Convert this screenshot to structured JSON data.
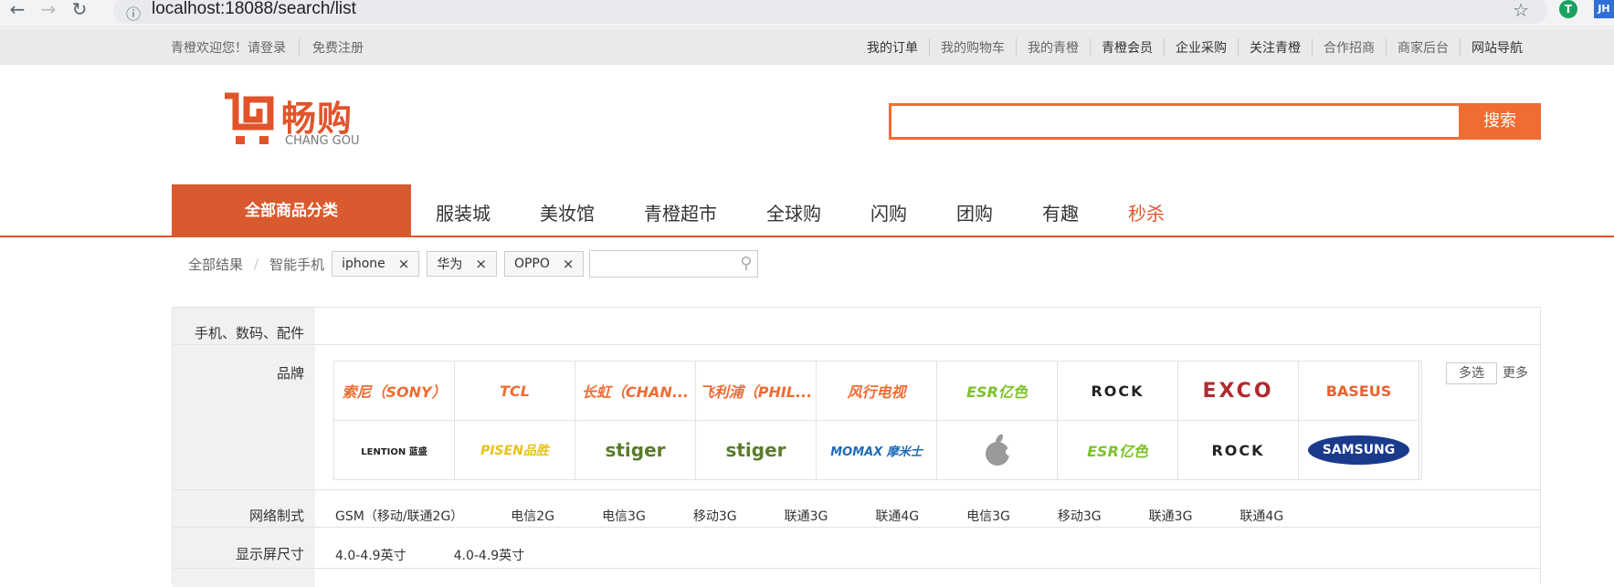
{
  "browser": {
    "url": "localhost:18088/search/list",
    "ext2": "JH"
  },
  "topbar": {
    "welcome": "青橙欢迎您！请登录",
    "register": "免费注册",
    "links": [
      "我的订单",
      "我的购物车",
      "我的青橙",
      "青橙会员",
      "企业采购",
      "关注青橙",
      "合作招商",
      "商家后台",
      "网站导航"
    ]
  },
  "logo": {
    "cn": "畅购",
    "en": "CHANG GOU"
  },
  "search": {
    "button": "搜索",
    "value": ""
  },
  "nav": {
    "all": "全部商品分类",
    "items": [
      "服装城",
      "美妆馆",
      "青橙超市",
      "全球购",
      "闪购",
      "团购",
      "有趣",
      "秒杀"
    ]
  },
  "breadcrumb": {
    "root": "全部结果",
    "sep": "/",
    "current": "智能手机",
    "tags": [
      "iphone",
      "华为",
      "OPPO"
    ],
    "close": "×"
  },
  "filters": {
    "category": "手机、数码、配件",
    "brand_label": "品牌",
    "brands_row1": [
      "索尼（SONY）",
      "TCL",
      "长虹（CHAN...",
      "飞利浦（PHIL...",
      "风行电视",
      "ESR亿色",
      "ROCK",
      "EXCO",
      "BASEUS"
    ],
    "brands_row2": [
      "LENTION 蓝盛",
      "PISEN品胜",
      "stiger",
      "stiger",
      "MOMAX 摩米士",
      "",
      "ESR亿色",
      "ROCK",
      "SAMSUNG"
    ],
    "multi": "多选",
    "more": "更多",
    "network_label": "网络制式",
    "network": [
      "GSM（移动/联通2G）",
      "电信2G",
      "电信3G",
      "移动3G",
      "联通3G",
      "联通4G",
      "电信3G",
      "移动3G",
      "联通3G",
      "联通4G"
    ],
    "screen_label": "显示屏尺寸",
    "screen": [
      "4.0-4.9英寸",
      "4.0-4.9英寸"
    ]
  },
  "colors": {
    "accent": "#ef6c33",
    "nav_bg": "#d95a2e"
  }
}
